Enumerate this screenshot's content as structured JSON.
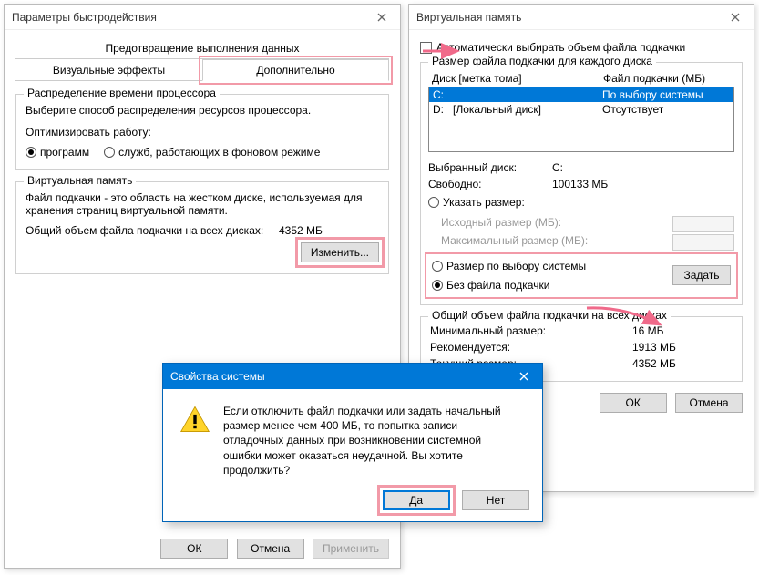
{
  "perf": {
    "title": "Параметры быстродействия",
    "tab_prevention": "Предотвращение выполнения данных",
    "tab_visual": "Визуальные эффекты",
    "tab_advanced": "Дополнительно",
    "cpu": {
      "title": "Распределение времени процессора",
      "desc": "Выберите способ распределения ресурсов процессора.",
      "optimize": "Оптимизировать работу:",
      "opt_programs": "программ",
      "opt_services": "служб, работающих в фоновом режиме"
    },
    "vm": {
      "title": "Виртуальная память",
      "desc": "Файл подкачки - это область на жестком диске, используемая для хранения страниц виртуальной памяти.",
      "total_label": "Общий объем файла подкачки на всех дисках:",
      "total_value": "4352 МБ",
      "change": "Изменить..."
    },
    "btn_ok": "ОК",
    "btn_cancel": "Отмена",
    "btn_apply": "Применить"
  },
  "vmem": {
    "title": "Виртуальная память",
    "auto": "Автоматически выбирать объем файла подкачки",
    "size_title": "Размер файла подкачки для каждого диска",
    "col_disk": "Диск [метка тома]",
    "col_page": "Файл подкачки (МБ)",
    "rows": [
      {
        "drv": "C:",
        "label": "",
        "page": "По выбору системы"
      },
      {
        "drv": "D:",
        "label": "[Локальный диск]",
        "page": "Отсутствует"
      }
    ],
    "sel_drive_label": "Выбранный диск:",
    "sel_drive_value": "C:",
    "free_label": "Свободно:",
    "free_value": "100133 МБ",
    "opt_custom": "Указать размер:",
    "init_label": "Исходный размер (МБ):",
    "max_label": "Максимальный размер (МБ):",
    "opt_system": "Размер по выбору системы",
    "opt_none": "Без файла подкачки",
    "set": "Задать",
    "totals_title": "Общий объем файла подкачки на всех дисках",
    "min_label": "Минимальный размер:",
    "min_value": "16 МБ",
    "rec_label": "Рекомендуется:",
    "rec_value": "1913 МБ",
    "cur_label": "Текущий размер:",
    "cur_value": "4352 МБ",
    "btn_ok": "ОК",
    "btn_cancel": "Отмена"
  },
  "dlg": {
    "title": "Свойства системы",
    "msg": "Если отключить файл подкачки или задать начальный размер менее чем 400 МБ, то попытка записи отладочных данных при возникновении системной ошибки может оказаться неудачной. Вы хотите продолжить?",
    "yes": "Да",
    "no": "Нет"
  }
}
